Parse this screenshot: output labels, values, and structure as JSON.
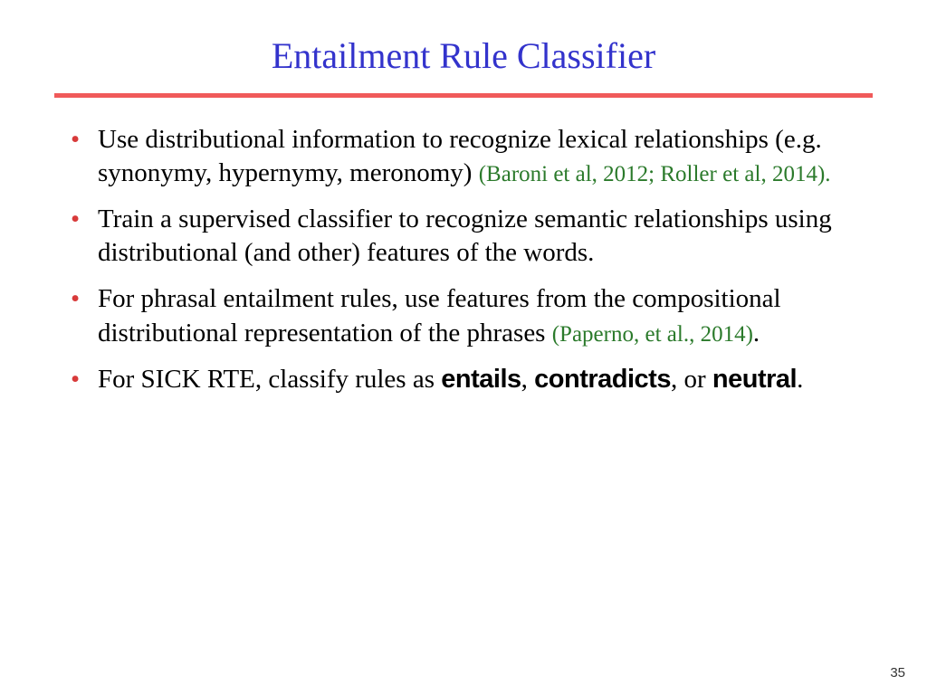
{
  "title": "Entailment Rule Classifier",
  "bullets": [
    {
      "text": "Use distributional information to recognize lexical relationships (e.g. synonymy, hypernymy, meronomy) ",
      "cite": "(Baroni et al, 2012; Roller et al, 2014)."
    },
    {
      "text": "Train a supervised classifier to recognize semantic relationships using distributional (and other) features of the words."
    },
    {
      "text": "For phrasal entailment rules, use features from the compositional distributional representation of the phrases ",
      "cite": "(Paperno, et al., 2014)",
      "trail": "."
    },
    {
      "pre": "For SICK RTE, classify rules as ",
      "b1": "entails",
      "s1": ", ",
      "b2": "contradicts",
      "s2": ", or ",
      "b3": "neutral",
      "post": "."
    }
  ],
  "page_number": "35"
}
